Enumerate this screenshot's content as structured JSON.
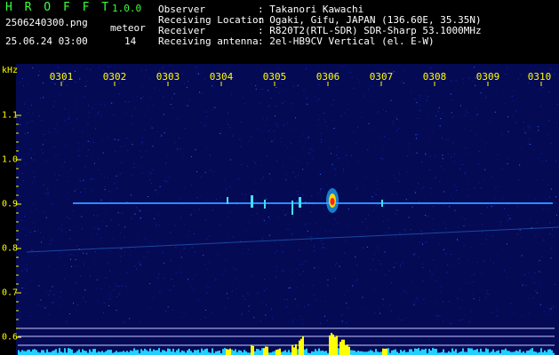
{
  "header": {
    "app_title": "H R O F F T",
    "app_version": "1.0.0",
    "file_name": "2506240300.png",
    "meteor_label": "meteor",
    "timestamp": "25.06.24 03:00",
    "meteor_count": "14"
  },
  "station_info": [
    {
      "label": "Observer",
      "value": ": Takanori Kawachi"
    },
    {
      "label": "Receiving Location",
      "value": ": Ogaki, Gifu, JAPAN (136.60E, 35.35N)"
    },
    {
      "label": "Receiver",
      "value": ": R820T2(RTL-SDR) SDR-Sharp 53.1000MHz"
    },
    {
      "label": "Receiving antenna",
      "value": ": 2el-HB9CV Vertical (el. E-W)"
    }
  ],
  "axis": {
    "unit": "kHz",
    "time_labels": [
      "0301",
      "0302",
      "0303",
      "0304",
      "0305",
      "0306",
      "0307",
      "0308",
      "0309",
      "0310"
    ],
    "freq_labels": [
      "1.1",
      "1.0",
      "0.9",
      "0.8",
      "0.7",
      "0.6"
    ]
  },
  "colors": {
    "label_yellow": "#ffff00",
    "title_green": "#3cff3c",
    "noise_blue": "#0a1a8a",
    "signal_cyan": "#00e5ff"
  }
}
